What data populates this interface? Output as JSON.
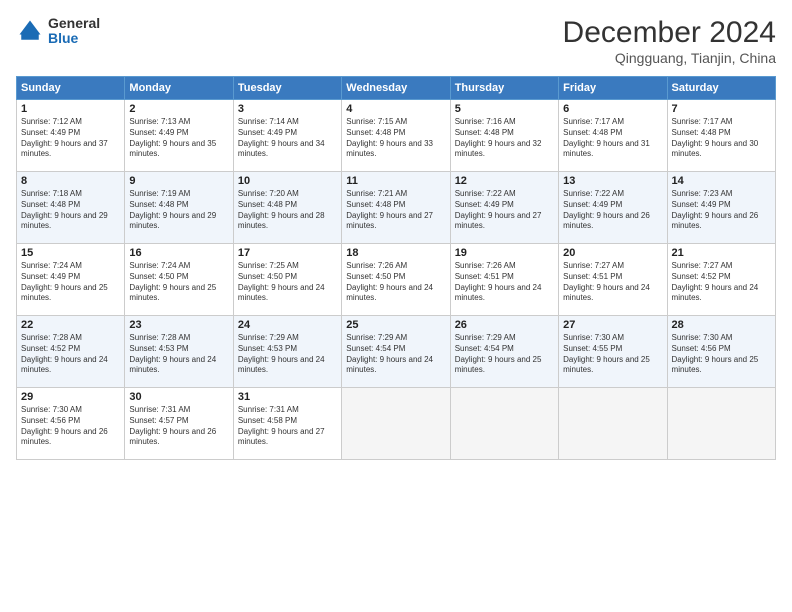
{
  "logo": {
    "general": "General",
    "blue": "Blue"
  },
  "title": "December 2024",
  "location": "Qingguang, Tianjin, China",
  "days_header": [
    "Sunday",
    "Monday",
    "Tuesday",
    "Wednesday",
    "Thursday",
    "Friday",
    "Saturday"
  ],
  "weeks": [
    [
      {
        "num": "1",
        "rise": "7:12 AM",
        "set": "4:49 PM",
        "daylight": "9 hours and 37 minutes."
      },
      {
        "num": "2",
        "rise": "7:13 AM",
        "set": "4:49 PM",
        "daylight": "9 hours and 35 minutes."
      },
      {
        "num": "3",
        "rise": "7:14 AM",
        "set": "4:49 PM",
        "daylight": "9 hours and 34 minutes."
      },
      {
        "num": "4",
        "rise": "7:15 AM",
        "set": "4:48 PM",
        "daylight": "9 hours and 33 minutes."
      },
      {
        "num": "5",
        "rise": "7:16 AM",
        "set": "4:48 PM",
        "daylight": "9 hours and 32 minutes."
      },
      {
        "num": "6",
        "rise": "7:17 AM",
        "set": "4:48 PM",
        "daylight": "9 hours and 31 minutes."
      },
      {
        "num": "7",
        "rise": "7:17 AM",
        "set": "4:48 PM",
        "daylight": "9 hours and 30 minutes."
      }
    ],
    [
      {
        "num": "8",
        "rise": "7:18 AM",
        "set": "4:48 PM",
        "daylight": "9 hours and 29 minutes."
      },
      {
        "num": "9",
        "rise": "7:19 AM",
        "set": "4:48 PM",
        "daylight": "9 hours and 29 minutes."
      },
      {
        "num": "10",
        "rise": "7:20 AM",
        "set": "4:48 PM",
        "daylight": "9 hours and 28 minutes."
      },
      {
        "num": "11",
        "rise": "7:21 AM",
        "set": "4:48 PM",
        "daylight": "9 hours and 27 minutes."
      },
      {
        "num": "12",
        "rise": "7:22 AM",
        "set": "4:49 PM",
        "daylight": "9 hours and 27 minutes."
      },
      {
        "num": "13",
        "rise": "7:22 AM",
        "set": "4:49 PM",
        "daylight": "9 hours and 26 minutes."
      },
      {
        "num": "14",
        "rise": "7:23 AM",
        "set": "4:49 PM",
        "daylight": "9 hours and 26 minutes."
      }
    ],
    [
      {
        "num": "15",
        "rise": "7:24 AM",
        "set": "4:49 PM",
        "daylight": "9 hours and 25 minutes."
      },
      {
        "num": "16",
        "rise": "7:24 AM",
        "set": "4:50 PM",
        "daylight": "9 hours and 25 minutes."
      },
      {
        "num": "17",
        "rise": "7:25 AM",
        "set": "4:50 PM",
        "daylight": "9 hours and 24 minutes."
      },
      {
        "num": "18",
        "rise": "7:26 AM",
        "set": "4:50 PM",
        "daylight": "9 hours and 24 minutes."
      },
      {
        "num": "19",
        "rise": "7:26 AM",
        "set": "4:51 PM",
        "daylight": "9 hours and 24 minutes."
      },
      {
        "num": "20",
        "rise": "7:27 AM",
        "set": "4:51 PM",
        "daylight": "9 hours and 24 minutes."
      },
      {
        "num": "21",
        "rise": "7:27 AM",
        "set": "4:52 PM",
        "daylight": "9 hours and 24 minutes."
      }
    ],
    [
      {
        "num": "22",
        "rise": "7:28 AM",
        "set": "4:52 PM",
        "daylight": "9 hours and 24 minutes."
      },
      {
        "num": "23",
        "rise": "7:28 AM",
        "set": "4:53 PM",
        "daylight": "9 hours and 24 minutes."
      },
      {
        "num": "24",
        "rise": "7:29 AM",
        "set": "4:53 PM",
        "daylight": "9 hours and 24 minutes."
      },
      {
        "num": "25",
        "rise": "7:29 AM",
        "set": "4:54 PM",
        "daylight": "9 hours and 24 minutes."
      },
      {
        "num": "26",
        "rise": "7:29 AM",
        "set": "4:54 PM",
        "daylight": "9 hours and 25 minutes."
      },
      {
        "num": "27",
        "rise": "7:30 AM",
        "set": "4:55 PM",
        "daylight": "9 hours and 25 minutes."
      },
      {
        "num": "28",
        "rise": "7:30 AM",
        "set": "4:56 PM",
        "daylight": "9 hours and 25 minutes."
      }
    ],
    [
      {
        "num": "29",
        "rise": "7:30 AM",
        "set": "4:56 PM",
        "daylight": "9 hours and 26 minutes."
      },
      {
        "num": "30",
        "rise": "7:31 AM",
        "set": "4:57 PM",
        "daylight": "9 hours and 26 minutes."
      },
      {
        "num": "31",
        "rise": "7:31 AM",
        "set": "4:58 PM",
        "daylight": "9 hours and 27 minutes."
      },
      null,
      null,
      null,
      null
    ]
  ]
}
